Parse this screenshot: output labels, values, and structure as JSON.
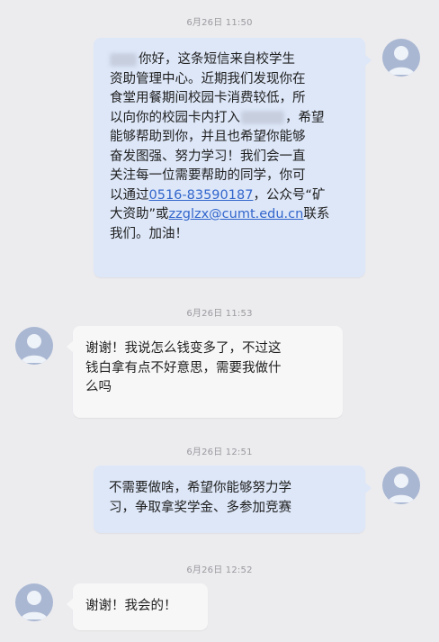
{
  "messages": [
    {
      "timestamp": "6月26日 11:50",
      "direction": "out",
      "lines": [
        {
          "parts": [
            {
              "text": "你好，这条短信来自校学生"
            }
          ]
        },
        {
          "parts": [
            {
              "text": "资助管理中心。近期我们发现你在"
            }
          ]
        },
        {
          "parts": [
            {
              "text": "食堂用餐期间校园卡消费较低，所"
            }
          ]
        },
        {
          "parts": [
            {
              "text": "以向你的校园卡内打入"
            },
            {
              "text": "，希望"
            }
          ]
        },
        {
          "parts": [
            {
              "text": "能够帮助到你，并且也希望你能够"
            }
          ]
        },
        {
          "parts": [
            {
              "text": "奋发图强、努力学习！我们会一直"
            }
          ]
        },
        {
          "parts": [
            {
              "text": "关注每一位需要帮助的同学，你可"
            }
          ]
        },
        {
          "parts": [
            {
              "text": "以通过"
            },
            {
              "text": "0516-83590187",
              "link": true
            },
            {
              "text": "，公众号“矿"
            }
          ]
        },
        {
          "parts": [
            {
              "text": "大资助”或"
            },
            {
              "text": "zzglzx@cumt.edu.cn",
              "link": true
            },
            {
              "text": "联系"
            }
          ]
        },
        {
          "parts": [
            {
              "text": "我们。加油！"
            }
          ]
        }
      ]
    },
    {
      "timestamp": "6月26日 11:53",
      "direction": "in",
      "lines": [
        {
          "parts": [
            {
              "text": "谢谢！我说怎么钱变多了，不过这"
            }
          ]
        },
        {
          "parts": [
            {
              "text": "钱白拿有点不好意思，需要我做什"
            }
          ]
        },
        {
          "parts": [
            {
              "text": "么吗"
            }
          ]
        }
      ]
    },
    {
      "timestamp": "6月26日 12:51",
      "direction": "out",
      "lines": [
        {
          "parts": [
            {
              "text": "不需要做啥，希望你能够努力学"
            }
          ]
        },
        {
          "parts": [
            {
              "text": "习，争取拿奖学金、多参加竞赛"
            }
          ]
        }
      ]
    },
    {
      "timestamp": "6月26日 12:52",
      "direction": "in",
      "lines": [
        {
          "parts": [
            {
              "text": "谢谢！我会的！"
            }
          ]
        }
      ]
    }
  ],
  "colors": {
    "outgoing_bubble": "#dde7f8",
    "incoming_bubble": "#f7f7f7",
    "link": "#3366cc",
    "avatar": "#a9b7d2"
  }
}
